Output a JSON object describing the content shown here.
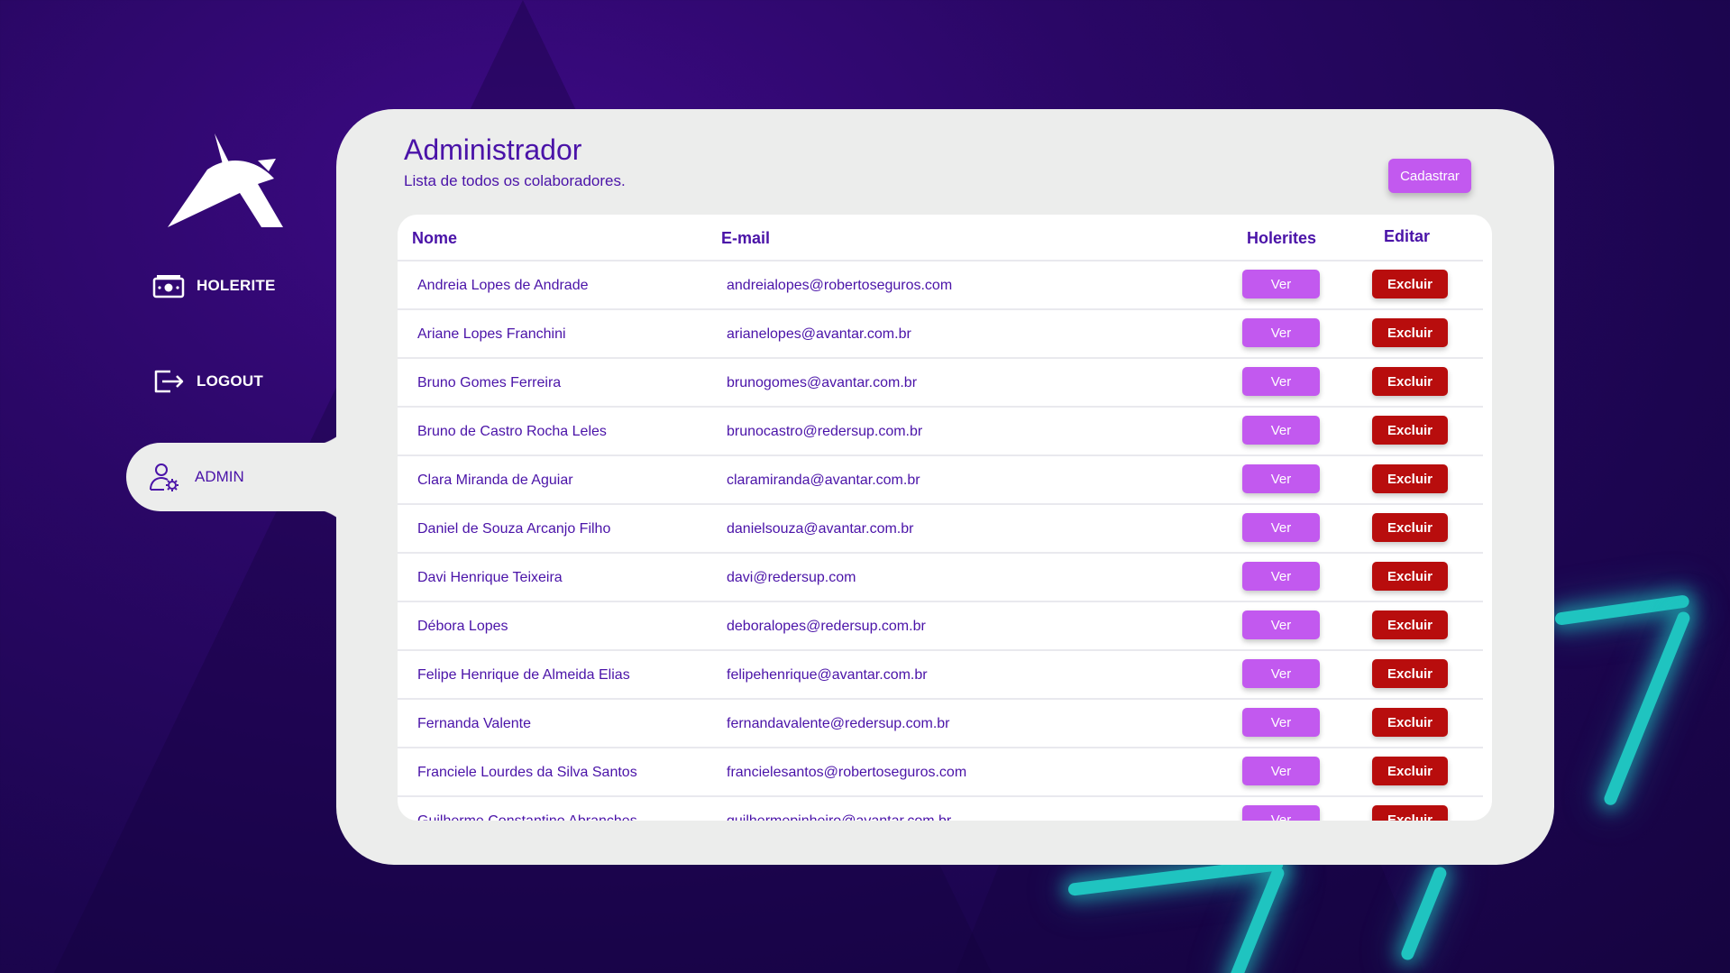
{
  "sidebar": {
    "items": [
      {
        "label": "HOLERITE",
        "icon": "money-icon"
      },
      {
        "label": "LOGOUT",
        "icon": "logout-icon"
      },
      {
        "label": "ADMIN",
        "icon": "user-settings-icon",
        "active": true
      }
    ]
  },
  "main": {
    "title": "Administrador",
    "subtitle": "Lista de todos os colaboradores.",
    "cadastrar_label": "Cadastrar",
    "table": {
      "headers": [
        "Nome",
        "E-mail",
        "Holerites",
        "Editar"
      ],
      "ver_label": "Ver",
      "excluir_label": "Excluir",
      "rows": [
        {
          "nome": "Andreia Lopes de Andrade",
          "email": "andreialopes@robertoseguros.com"
        },
        {
          "nome": "Ariane Lopes Franchini",
          "email": "arianelopes@avantar.com.br"
        },
        {
          "nome": "Bruno Gomes Ferreira",
          "email": "brunogomes@avantar.com.br"
        },
        {
          "nome": "Bruno de Castro Rocha Leles",
          "email": "brunocastro@redersup.com.br"
        },
        {
          "nome": "Clara Miranda de Aguiar",
          "email": "claramiranda@avantar.com.br"
        },
        {
          "nome": "Daniel de Souza Arcanjo Filho",
          "email": "danielsouza@avantar.com.br"
        },
        {
          "nome": "Davi Henrique Teixeira",
          "email": "davi@redersup.com"
        },
        {
          "nome": "Débora Lopes",
          "email": "deboralopes@redersup.com.br"
        },
        {
          "nome": "Felipe Henrique de Almeida Elias",
          "email": "felipehenrique@avantar.com.br"
        },
        {
          "nome": "Fernanda Valente",
          "email": "fernandavalente@redersup.com.br"
        },
        {
          "nome": "Franciele Lourdes da Silva Santos",
          "email": "francielesantos@robertoseguros.com"
        },
        {
          "nome": "Guilherme Constantino Abranches",
          "email": "guilhermepinheiro@avantar.com.br"
        }
      ]
    }
  },
  "colors": {
    "primary": "#4a13a8",
    "accent_button": "#c259ef",
    "danger_button": "#b80d0d",
    "panel_bg": "#ecedec",
    "neon": "#1fc4c0"
  }
}
